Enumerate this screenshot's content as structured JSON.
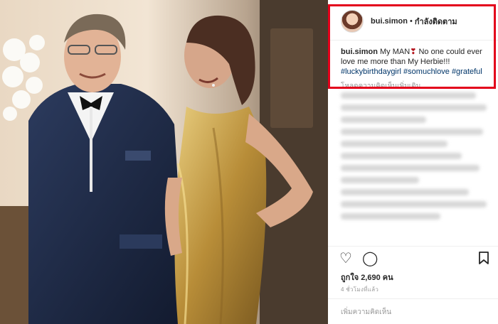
{
  "post": {
    "username": "bui.simon",
    "separator": "•",
    "follow_label": "กำลังติดตาม",
    "caption_user": "bui.simon",
    "caption_text_1": "My MAN",
    "caption_heart": "❣",
    "caption_text_2": "No one could ever love me more than My Herbie!!!",
    "hashtags": [
      "#luckybirthdaygirl",
      "#somuchlove",
      "#grateful"
    ],
    "view_more_comments": "โหลดความคิดเห็นเพิ่มเติม",
    "likes_label": "ถูกใจ 2,690 คน",
    "timestamp": "4 ชั่วโมงที่แล้ว",
    "add_comment_placeholder": "เพิ่มความคิดเห็น"
  },
  "icons": {
    "like": "heart-outline-icon",
    "comment": "speech-bubble-icon",
    "save": "bookmark-icon"
  },
  "colors": {
    "highlight_border": "#e3001b",
    "hashtag": "#003569",
    "heart": "#b3121b",
    "gold_dress": "#c9a24a",
    "velvet_jacket": "#1c2740"
  }
}
